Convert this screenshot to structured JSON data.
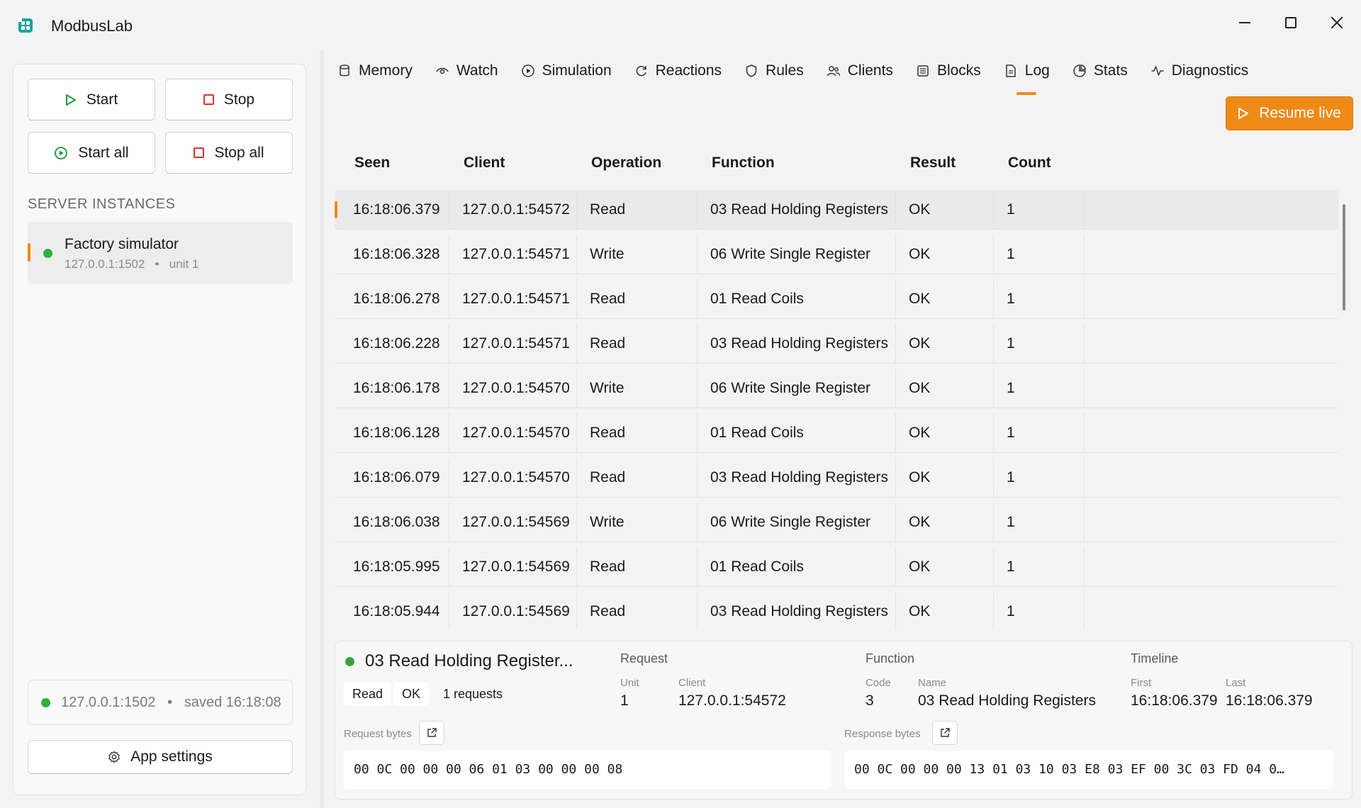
{
  "app": {
    "title": "ModbusLab"
  },
  "sidebar": {
    "start_label": "Start",
    "stop_label": "Stop",
    "start_all_label": "Start all",
    "stop_all_label": "Stop all",
    "section_title": "SERVER INSTANCES",
    "server": {
      "name": "Factory simulator",
      "address": "127.0.0.1:1502",
      "unit": "unit 1"
    },
    "status": {
      "address": "127.0.0.1:1502",
      "saved": "saved 16:18:08"
    },
    "settings_label": "App settings"
  },
  "tabs": [
    {
      "label": "Memory",
      "icon": "database-icon"
    },
    {
      "label": "Watch",
      "icon": "eye-icon"
    },
    {
      "label": "Simulation",
      "icon": "play-circle-icon"
    },
    {
      "label": "Reactions",
      "icon": "refresh-icon"
    },
    {
      "label": "Rules",
      "icon": "shield-icon"
    },
    {
      "label": "Clients",
      "icon": "users-icon"
    },
    {
      "label": "Blocks",
      "icon": "blocks-icon"
    },
    {
      "label": "Log",
      "icon": "file-icon",
      "active": true
    },
    {
      "label": "Stats",
      "icon": "stats-icon"
    },
    {
      "label": "Diagnostics",
      "icon": "pulse-icon"
    }
  ],
  "resume_label": "Resume live",
  "table": {
    "headers": [
      "Seen",
      "Client",
      "Operation",
      "Function",
      "Result",
      "Count"
    ],
    "rows": [
      [
        "16:18:06.379",
        "127.0.0.1:54572",
        "Read",
        "03 Read Holding Registers",
        "OK",
        "1"
      ],
      [
        "16:18:06.328",
        "127.0.0.1:54571",
        "Write",
        "06 Write Single Register",
        "OK",
        "1"
      ],
      [
        "16:18:06.278",
        "127.0.0.1:54571",
        "Read",
        "01 Read Coils",
        "OK",
        "1"
      ],
      [
        "16:18:06.228",
        "127.0.0.1:54571",
        "Read",
        "03 Read Holding Registers",
        "OK",
        "1"
      ],
      [
        "16:18:06.178",
        "127.0.0.1:54570",
        "Write",
        "06 Write Single Register",
        "OK",
        "1"
      ],
      [
        "16:18:06.128",
        "127.0.0.1:54570",
        "Read",
        "01 Read Coils",
        "OK",
        "1"
      ],
      [
        "16:18:06.079",
        "127.0.0.1:54570",
        "Read",
        "03 Read Holding Registers",
        "OK",
        "1"
      ],
      [
        "16:18:06.038",
        "127.0.0.1:54569",
        "Write",
        "06 Write Single Register",
        "OK",
        "1"
      ],
      [
        "16:18:05.995",
        "127.0.0.1:54569",
        "Read",
        "01 Read Coils",
        "OK",
        "1"
      ],
      [
        "16:18:05.944",
        "127.0.0.1:54569",
        "Read",
        "03 Read Holding Registers",
        "OK",
        "1"
      ]
    ]
  },
  "detail": {
    "title": "03 Read Holding Register...",
    "chips": [
      "Read",
      "OK",
      "1 requests"
    ],
    "request": {
      "heading": "Request",
      "unit_label": "Unit",
      "unit": "1",
      "client_label": "Client",
      "client": "127.0.0.1:54572"
    },
    "function": {
      "heading": "Function",
      "code_label": "Code",
      "code": "3",
      "name_label": "Name",
      "name": "03 Read Holding Registers"
    },
    "timeline": {
      "heading": "Timeline",
      "first_label": "First",
      "first": "16:18:06.379",
      "last_label": "Last",
      "last": "16:18:06.379"
    },
    "request_bytes_label": "Request bytes",
    "request_bytes": "00 0C 00 00 00 06 01 03 00 00 00 08",
    "response_bytes_label": "Response bytes",
    "response_bytes": "00 0C 00 00 00 13 01 03 10 03 E8 03 EF 00 3C 03 FD 04 0…"
  },
  "colors": {
    "accent": "#f08a16",
    "status_ok": "#2ab33a",
    "stop_red": "#d9342b"
  }
}
